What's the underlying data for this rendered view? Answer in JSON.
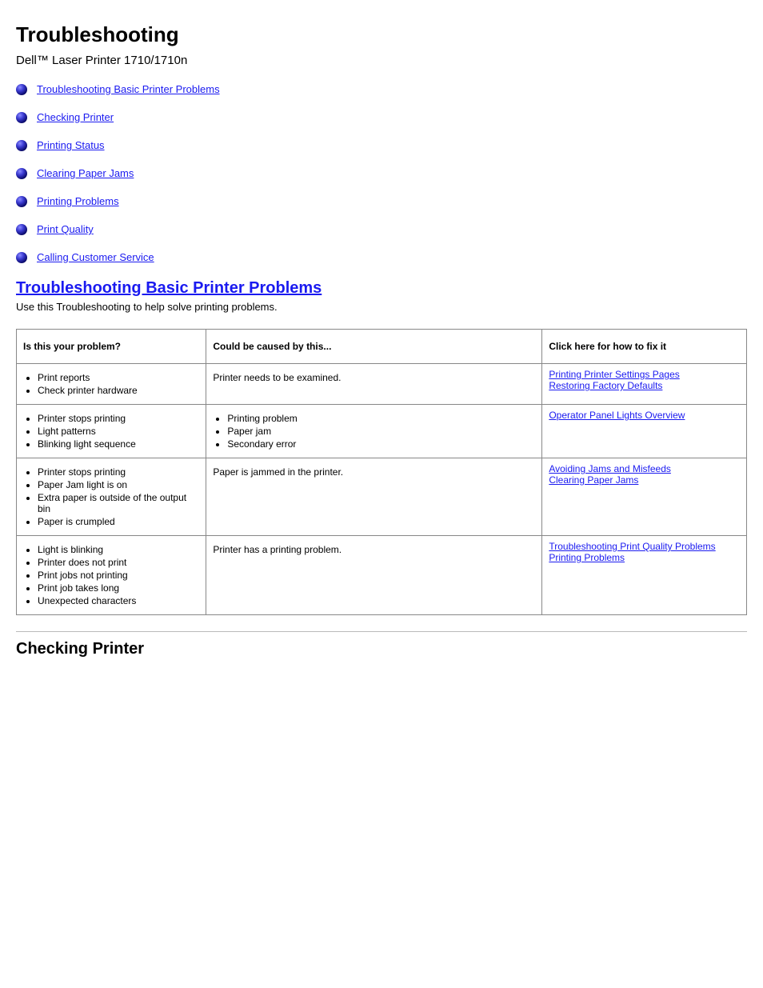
{
  "title": "Troubleshooting",
  "subtitle": "Dell™ Laser Printer 1710/1710n",
  "nav": [
    {
      "label": "Troubleshooting Basic Printer Problems"
    },
    {
      "label": "Checking Printer"
    },
    {
      "label": "Printing Status"
    },
    {
      "label": "Clearing Paper Jams"
    },
    {
      "label": "Printing Problems"
    },
    {
      "label": "Print Quality"
    },
    {
      "label": "Calling Customer Service"
    }
  ],
  "section1": {
    "heading": "Troubleshooting Basic Printer Problems",
    "sub": "Use this Troubleshooting to help solve printing problems."
  },
  "table": {
    "headers": [
      "Is this your problem?",
      "Could be caused by this...",
      "Click here for how to fix it"
    ],
    "rows": [
      {
        "c1": {
          "type": "list",
          "items": [
            "Print reports",
            "Check printer hardware"
          ]
        },
        "c2": {
          "type": "text",
          "value": "Printer needs to be examined."
        },
        "c3": {
          "type": "links",
          "items": [
            "Printing Printer Settings Pages",
            "Restoring Factory Defaults"
          ]
        }
      },
      {
        "c1": {
          "type": "list",
          "items": [
            "Printer stops printing",
            "Light patterns",
            "Blinking light sequence"
          ]
        },
        "c2": {
          "type": "list",
          "items": [
            "Printing problem",
            "Paper jam",
            "Secondary error"
          ]
        },
        "c3": {
          "type": "links",
          "items": [
            "Operator Panel Lights Overview"
          ]
        }
      },
      {
        "c1": {
          "type": "list",
          "items": [
            "Printer stops printing",
            "Paper Jam light is on",
            "Extra paper is outside of the output bin",
            "Paper is crumpled"
          ]
        },
        "c2": {
          "type": "text",
          "value": "Paper is jammed in the printer."
        },
        "c3": {
          "type": "links",
          "items": [
            "Avoiding Jams and Misfeeds",
            "Clearing Paper Jams"
          ]
        }
      },
      {
        "c1": {
          "type": "list",
          "items": [
            "Light is blinking",
            "Printer does not print",
            "Print jobs not printing",
            "Print job takes long",
            "Unexpected characters"
          ]
        },
        "c2": {
          "type": "text",
          "value": "Printer has a printing problem."
        },
        "c3": {
          "type": "links",
          "items": [
            "Troubleshooting Print Quality Problems",
            "Printing Problems"
          ]
        }
      }
    ]
  },
  "footer_heading": "Checking Printer"
}
